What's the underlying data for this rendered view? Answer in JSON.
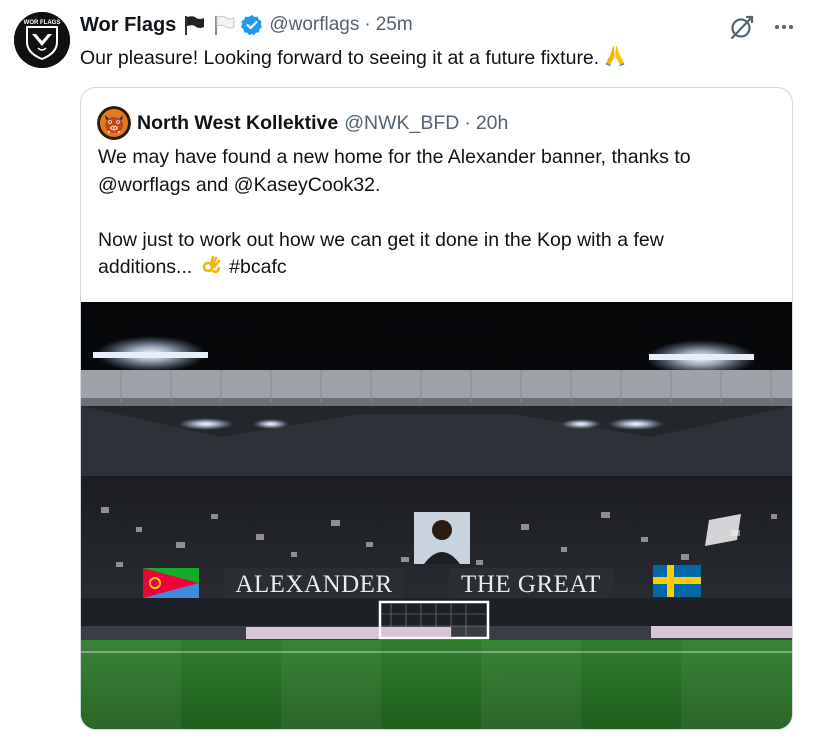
{
  "tweet": {
    "author_name": "Wor Flags",
    "handle": "@worflags",
    "separator": "·",
    "time": "25m",
    "text": "Our pleasure! Looking forward to seeing it at a future fixture.",
    "avatar_logo_text": "WOR FLAGS",
    "icons": {
      "flags": "black-and-white-flag-icons",
      "verified": "verified-badge-icon",
      "grok": "grok-icon",
      "more": "more-icon",
      "emoji": "folded-hands-emoji"
    }
  },
  "quote": {
    "author_name": "North West Kollektive",
    "handle": "@NWK_BFD",
    "separator": "·",
    "time": "20h",
    "line1": "We may have found a new home for the Alexander banner, thanks to",
    "line2": "@worflags and @KaseyCook32.",
    "line3": "Now just to work out how we can get it done in the Kop with a few",
    "line4_before": "additions...",
    "line4_after": "#bcafc",
    "emoji": "ok-hand-emoji",
    "image": {
      "banner_left": "ALEXANDER",
      "banner_right": "THE GREAT",
      "description_icons": [
        "eritrea-flag",
        "sweden-flag",
        "tifo-portrait"
      ]
    }
  },
  "colors": {
    "text": "#0f1419",
    "secondary": "#536471",
    "verified": "#1d9bf0",
    "border": "#cfd9de"
  }
}
